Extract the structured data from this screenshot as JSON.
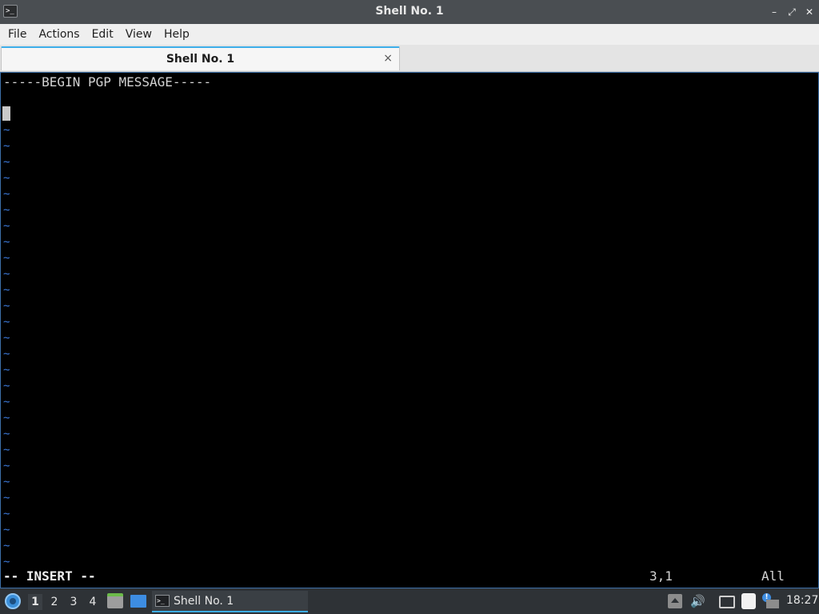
{
  "window": {
    "title": "Shell No. 1",
    "app_icon": "terminal-icon",
    "controls": {
      "minimize": "–",
      "maximize": "⤢",
      "close": "✕"
    }
  },
  "menu": [
    "File",
    "Actions",
    "Edit",
    "View",
    "Help"
  ],
  "tabs": [
    {
      "label": "Shell No. 1",
      "close": "×"
    }
  ],
  "terminal": {
    "lines": [
      "-----BEGIN PGP MESSAGE-----",
      "",
      ""
    ],
    "empty_marker": "~",
    "mode": "-- INSERT --",
    "position": "3,1",
    "scroll": "All"
  },
  "taskbar": {
    "desktops": [
      "1",
      "2",
      "3",
      "4"
    ],
    "active_desktop": "1",
    "launchers": [
      "file-manager-icon",
      "show-desktop-icon"
    ],
    "tasks": [
      {
        "label": "Shell No. 1",
        "icon": "terminal-icon"
      }
    ],
    "tray": {
      "volume_glyph": "🔊",
      "update_badge": "!"
    },
    "clock": "18:27"
  },
  "colors": {
    "accent": "#3daee9",
    "tilde": "#3b78d8",
    "titlebar": "#4a4e52",
    "taskbar": "#2e3236"
  }
}
